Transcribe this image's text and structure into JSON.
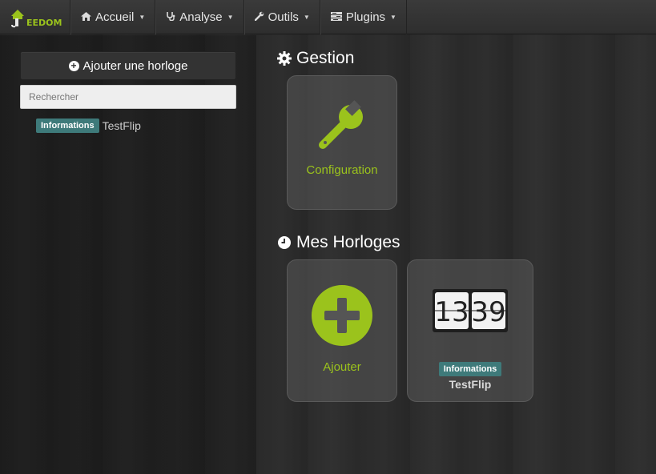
{
  "navbar": {
    "brand": {
      "letter": "J",
      "text": "EEDOM"
    },
    "items": [
      {
        "label": "Accueil",
        "icon": "home-icon"
      },
      {
        "label": "Analyse",
        "icon": "stethoscope-icon"
      },
      {
        "label": "Outils",
        "icon": "wrench-icon"
      },
      {
        "label": "Plugins",
        "icon": "tasks-icon"
      }
    ]
  },
  "sidebar": {
    "add_button": "Ajouter une horloge",
    "search_placeholder": "Rechercher",
    "items": [
      {
        "badge": "Informations",
        "name": "TestFlip"
      }
    ]
  },
  "main": {
    "gestion": {
      "title": "Gestion",
      "config_label": "Configuration"
    },
    "horloges": {
      "title": "Mes Horloges",
      "add_label": "Ajouter",
      "devices": [
        {
          "badge": "Informations",
          "name": "TestFlip",
          "time_h": "13",
          "time_m": "39"
        }
      ]
    }
  },
  "colors": {
    "accent": "#9bc31c",
    "badge": "#3e7a7a"
  }
}
